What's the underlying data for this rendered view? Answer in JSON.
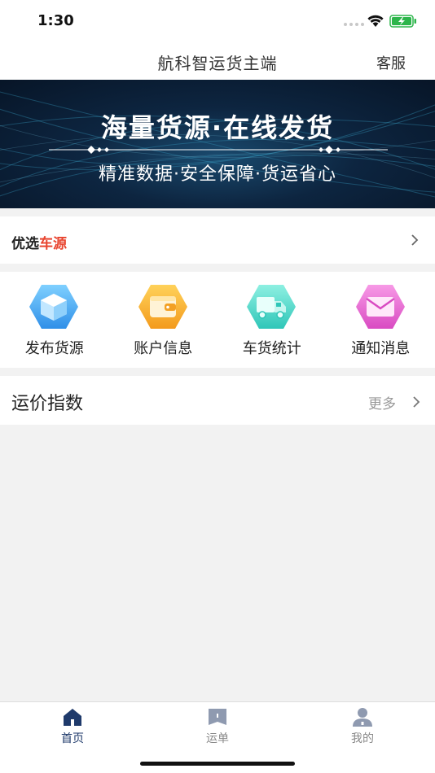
{
  "status": {
    "time": "1:30"
  },
  "header": {
    "title": "航科智运货主端",
    "service": "客服"
  },
  "banner": {
    "line1": "海量货源·在线发货",
    "line2": "精准数据·安全保障·货运省心"
  },
  "youxuan": {
    "part1": "优选",
    "part2": "车源"
  },
  "quick": [
    {
      "label": "发布货源",
      "icon": "box-icon"
    },
    {
      "label": "账户信息",
      "icon": "wallet-icon"
    },
    {
      "label": "车货统计",
      "icon": "truck-icon"
    },
    {
      "label": "通知消息",
      "icon": "mail-icon"
    }
  ],
  "index": {
    "title": "运价指数",
    "more": "更多"
  },
  "tabs": [
    {
      "label": "首页",
      "icon": "home-icon",
      "active": true
    },
    {
      "label": "运单",
      "icon": "waybill-icon",
      "active": false
    },
    {
      "label": "我的",
      "icon": "profile-icon",
      "active": false
    }
  ],
  "colors": {
    "accent": "#1f3a6b",
    "highlight": "#e8442f",
    "inactive": "#888888"
  }
}
